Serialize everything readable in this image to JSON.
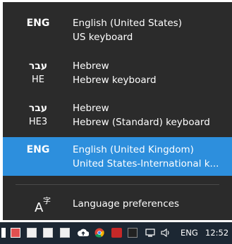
{
  "languages": [
    {
      "abbr": "ENG",
      "sub": "",
      "name": "English (United States)",
      "keyboard": "US keyboard",
      "selected": false
    },
    {
      "abbr": "עבר",
      "sub": "HE",
      "name": "Hebrew",
      "keyboard": "Hebrew keyboard",
      "selected": false
    },
    {
      "abbr": "עבר",
      "sub": "HE3",
      "name": "Hebrew",
      "keyboard": "Hebrew (Standard) keyboard",
      "selected": false
    },
    {
      "abbr": "ENG",
      "sub": "",
      "name": "English (United Kingdom)",
      "keyboard": "United States-International k...",
      "selected": true
    }
  ],
  "preferences": {
    "label": "Language preferences",
    "icon": "language-settings-icon"
  },
  "taskbar": {
    "language": "ENG",
    "time": "12:52",
    "icons": [
      "app-red-icon",
      "app-white-icon",
      "app-white-icon",
      "app-white-icon",
      "app-white-icon",
      "cloud-upload-icon",
      "chrome-icon",
      "app-red-icon",
      "app-dark-icon",
      "battery-icon",
      "network-icon",
      "volume-icon"
    ]
  },
  "colors": {
    "flyout_bg": "#2b2b2b",
    "selected_bg": "#2d8fdd",
    "taskbar_bg": "#1c2733"
  }
}
